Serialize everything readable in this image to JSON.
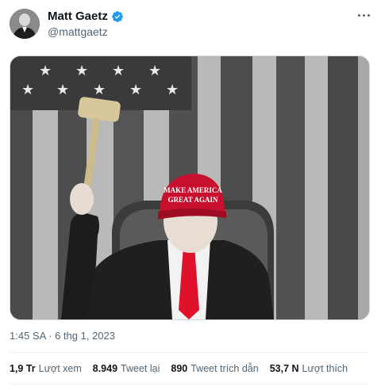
{
  "author": {
    "name": "Matt Gaetz",
    "handle": "@mattgaetz",
    "verified": true,
    "verified_color": "#1d9bf0"
  },
  "media": {
    "cap_text_line1": "MAKE AMERICA",
    "cap_text_line2": "GREAT AGAIN",
    "cap_color": "#c8102e",
    "tie_color": "#e0112b"
  },
  "timestamp": "1:45 SA · 6 thg 1, 2023",
  "stats": [
    {
      "num": "1,9 Tr",
      "label": "Lượt xem"
    },
    {
      "num": "8.949",
      "label": "Tweet lại"
    },
    {
      "num": "890",
      "label": "Tweet trích dẫn"
    },
    {
      "num": "53,7 N",
      "label": "Lượt thích"
    }
  ],
  "icons": {
    "more": "more-dots-icon",
    "verified": "verified-badge-icon"
  }
}
